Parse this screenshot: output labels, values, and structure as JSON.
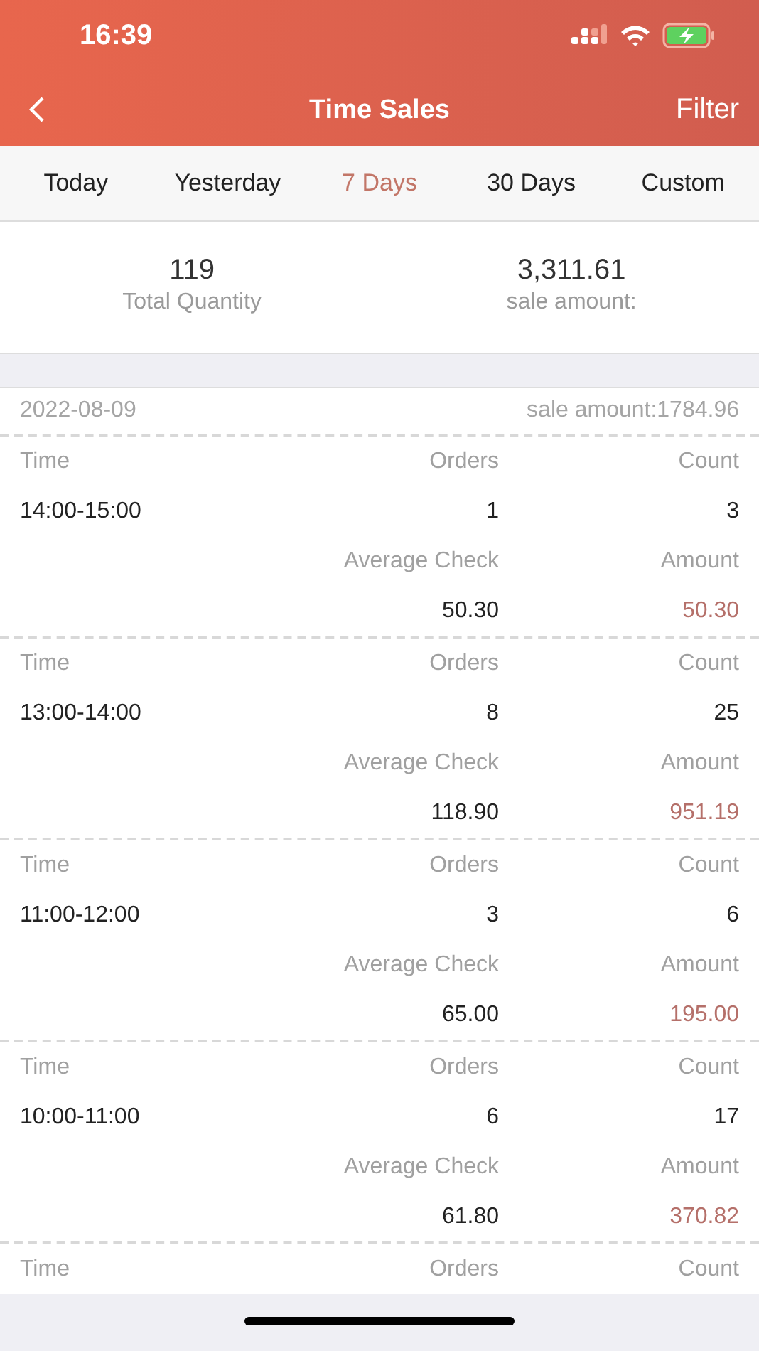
{
  "status_bar": {
    "time": "16:39"
  },
  "nav": {
    "title": "Time Sales",
    "action": "Filter"
  },
  "tabs": [
    {
      "label": "Today",
      "selected": false
    },
    {
      "label": "Yesterday",
      "selected": false
    },
    {
      "label": "7 Days",
      "selected": true
    },
    {
      "label": "30 Days",
      "selected": false
    },
    {
      "label": "Custom",
      "selected": false
    }
  ],
  "summary": [
    {
      "value": "119",
      "label": "Total Quantity"
    },
    {
      "value": "3,311.61",
      "label": "sale amount:"
    }
  ],
  "day": {
    "date": "2022-08-09",
    "total": "sale amount:1784.96"
  },
  "slots": [
    {
      "time_label": "Time",
      "orders_label": "Orders",
      "count_label": "Count",
      "time": "14:00-15:00",
      "orders": "1",
      "count": "3",
      "avg_label": "Average Check",
      "amount_label": "Amount",
      "avg": "50.30",
      "amount": "50.30"
    },
    {
      "time_label": "Time",
      "orders_label": "Orders",
      "count_label": "Count",
      "time": "13:00-14:00",
      "orders": "8",
      "count": "25",
      "avg_label": "Average Check",
      "amount_label": "Amount",
      "avg": "118.90",
      "amount": "951.19"
    },
    {
      "time_label": "Time",
      "orders_label": "Orders",
      "count_label": "Count",
      "time": "11:00-12:00",
      "orders": "3",
      "count": "6",
      "avg_label": "Average Check",
      "amount_label": "Amount",
      "avg": "65.00",
      "amount": "195.00"
    },
    {
      "time_label": "Time",
      "orders_label": "Orders",
      "count_label": "Count",
      "time": "10:00-11:00",
      "orders": "6",
      "count": "17",
      "avg_label": "Average Check",
      "amount_label": "Amount",
      "avg": "61.80",
      "amount": "370.82"
    },
    {
      "time_label": "Time",
      "orders_label": "Orders",
      "count_label": "Count"
    }
  ]
}
